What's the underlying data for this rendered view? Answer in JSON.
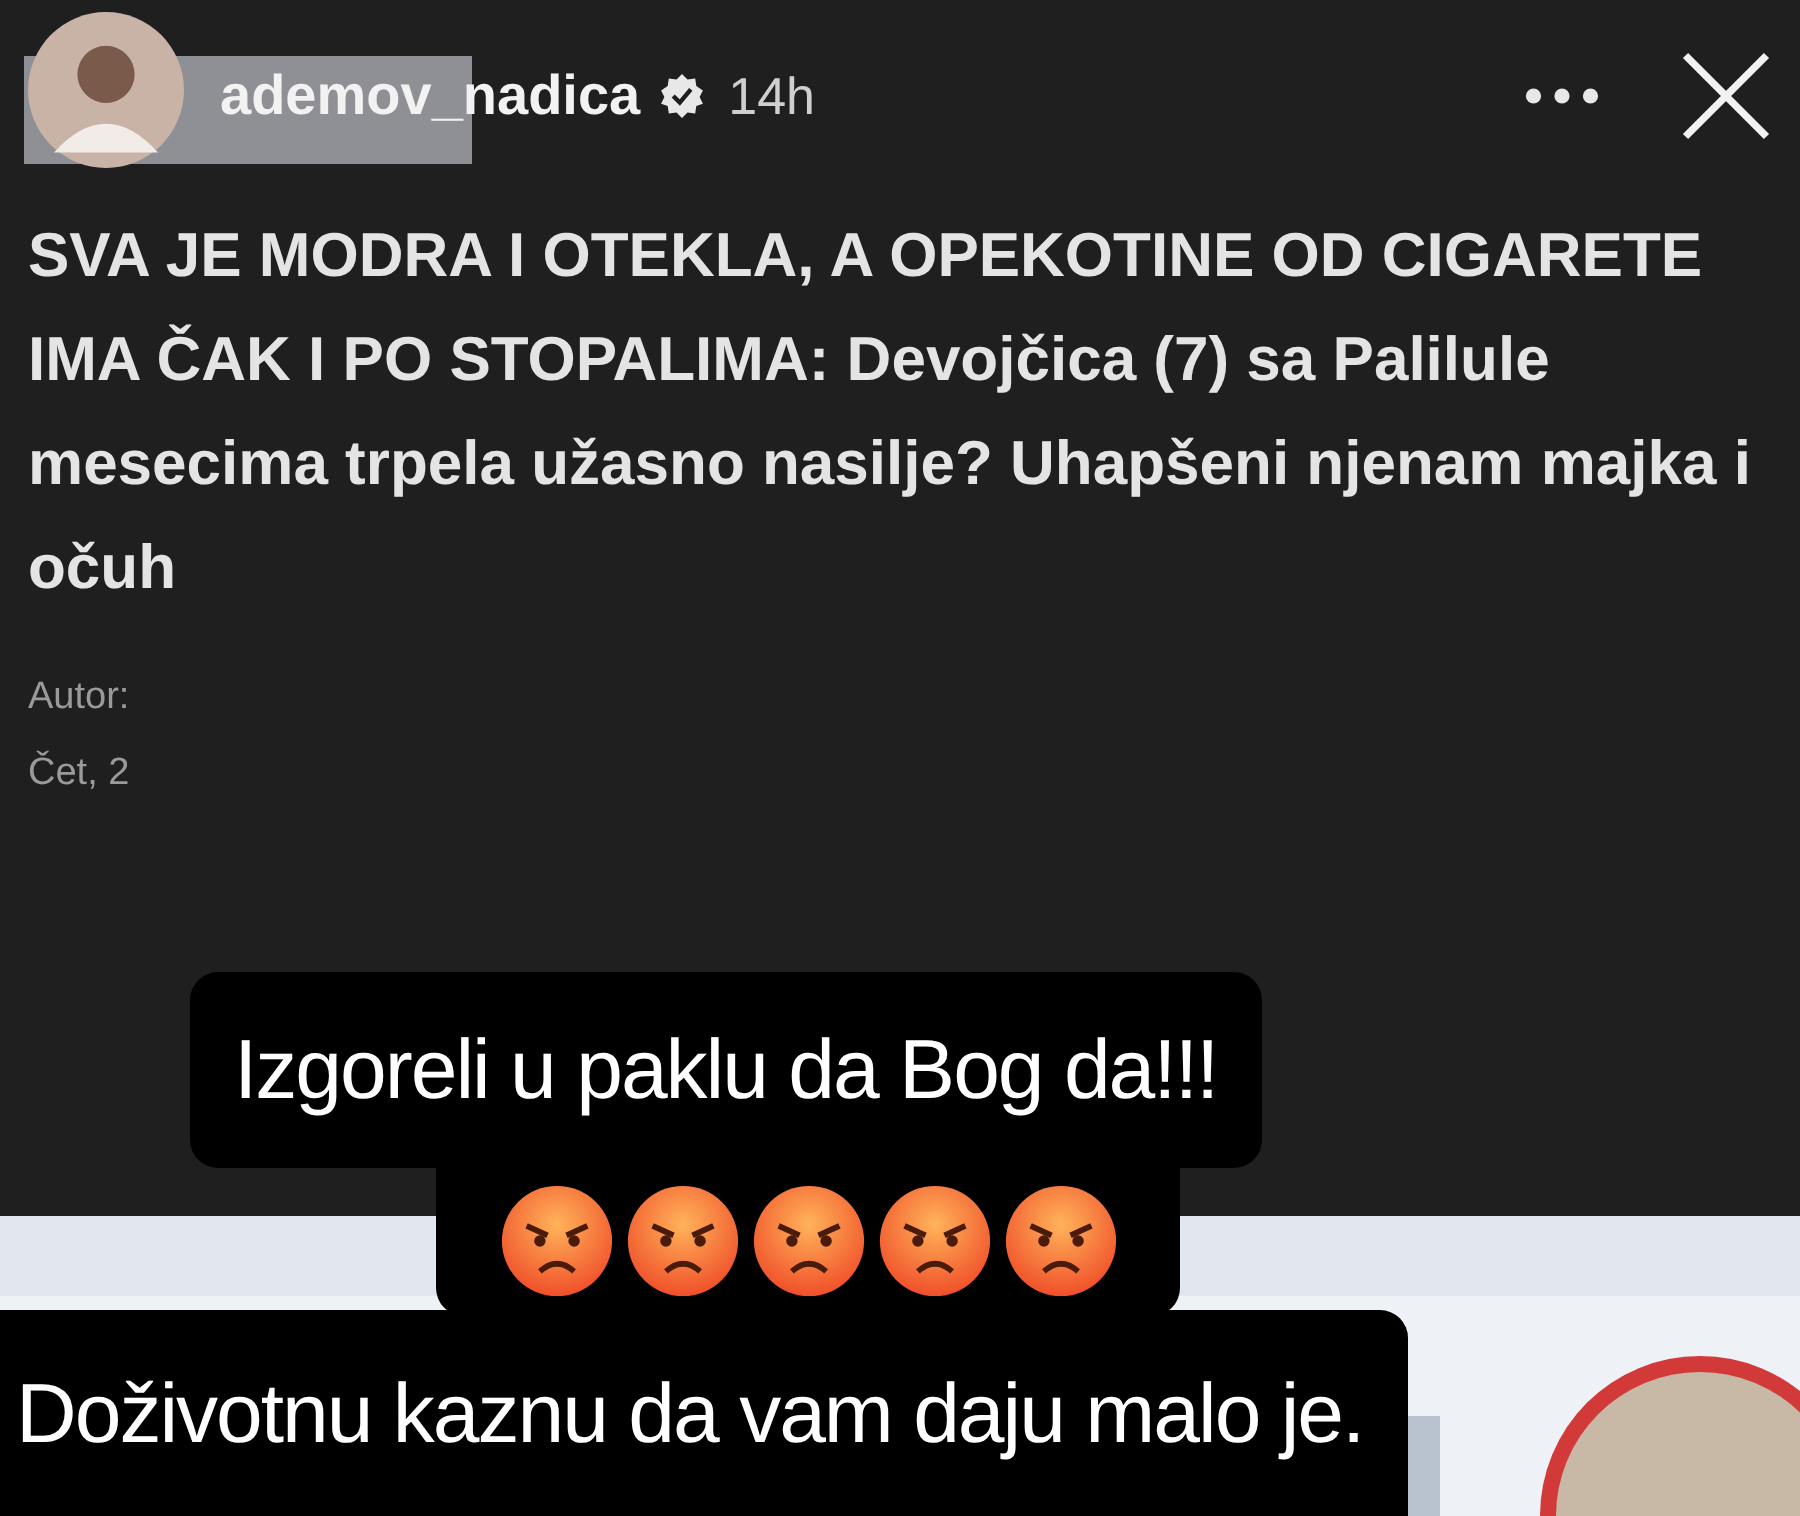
{
  "story": {
    "username": "ademov_nadica",
    "verified": true,
    "time": "14h"
  },
  "post": {
    "headline": "SVA JE MODRA I OTEKLA, A OPEKOTINE OD CIGARETE IMA ČAK I PO STOPALIMA: Devojčica (7) sa Palilule mesecima trpela užasno nasilje? Uhapšeni njenam majka i očuh",
    "author_label": "Autor:",
    "date": "Čet, 2"
  },
  "captions": [
    {
      "kind": "text",
      "text": "Izgoreli u paklu da Bog da!!!"
    },
    {
      "kind": "emoji_row"
    },
    {
      "kind": "text",
      "text": "Doživotnu kaznu da vam daju malo je."
    }
  ]
}
